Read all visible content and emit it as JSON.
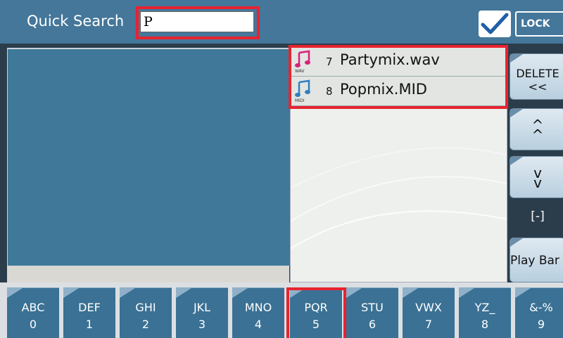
{
  "header": {
    "quick_search_label": "Quick Search",
    "search_value": "P",
    "lock_label": "LOCK"
  },
  "file_list": [
    {
      "number": "7",
      "name": "Partymix.wav",
      "type_label": "WAV",
      "icon": "music-note-icon",
      "icon_color": "#d6217a"
    },
    {
      "number": "8",
      "name": "Popmix.MID",
      "type_label": "MIDI",
      "icon": "music-note-icon",
      "icon_color": "#2f7fc1"
    }
  ],
  "side_buttons": {
    "delete_label": "DELETE",
    "delete_arrows": "<<",
    "up_arrows": "^\n^",
    "down_arrows": "v\nv",
    "page_indicator": "[-]",
    "play_label": "Play Bar"
  },
  "keypad": [
    {
      "letters": "ABC",
      "digit": "0"
    },
    {
      "letters": "DEF",
      "digit": "1"
    },
    {
      "letters": "GHI",
      "digit": "2"
    },
    {
      "letters": "JKL",
      "digit": "3"
    },
    {
      "letters": "MNO",
      "digit": "4"
    },
    {
      "letters": "PQR",
      "digit": "5"
    },
    {
      "letters": "STU",
      "digit": "6"
    },
    {
      "letters": "VWX",
      "digit": "7"
    },
    {
      "letters": "YZ_",
      "digit": "8"
    },
    {
      "letters": "&-%",
      "digit": "9"
    }
  ],
  "colors": {
    "header_bg": "#44779a",
    "highlight": "#e8232f",
    "key_bg": "#3a7194",
    "check_color": "#1f5fa8"
  }
}
